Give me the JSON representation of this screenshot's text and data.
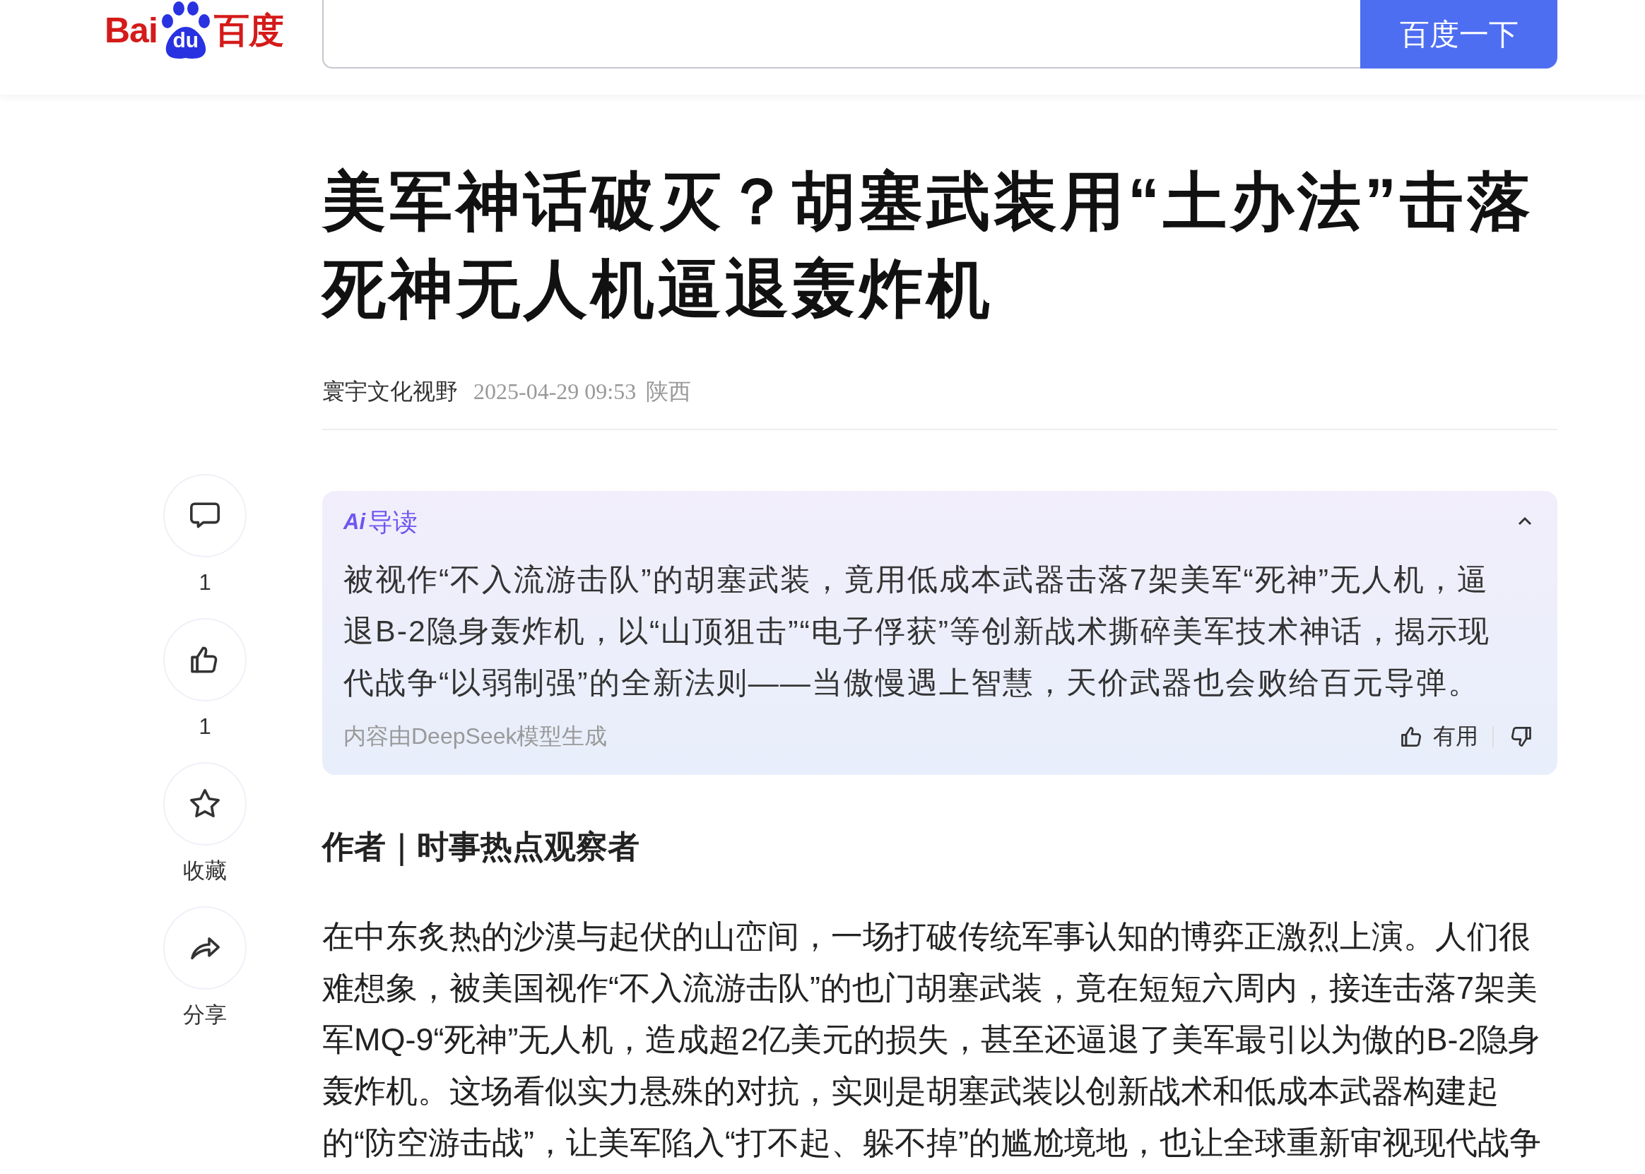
{
  "header": {
    "logo": {
      "text_left": "Bai",
      "paw_text": "du",
      "text_right": "百度"
    },
    "search": {
      "button": "百度一下"
    }
  },
  "article": {
    "title": "美军神话破灭？胡塞武装用“土办法”击落死神无人机逼退轰炸机",
    "source": "寰宇文化视野",
    "time": "2025-04-29 09:53",
    "region": "陕西"
  },
  "actions": [
    {
      "kind": "comment",
      "label": "1"
    },
    {
      "kind": "like",
      "label": "1"
    },
    {
      "kind": "favorite",
      "label": "收藏"
    },
    {
      "kind": "share",
      "label": "分享"
    }
  ],
  "ai_summary": {
    "badge": "Ai",
    "title": "导读",
    "expanded": true,
    "text": "被视作“不入流游击队”的胡塞武装，竟用低成本武器击落7架美军“死神”无人机，逼退B-2隐身轰炸机，以“山顶狙击”“电子俘获”等创新战术撕碎美军技术神话，揭示现代战争“以弱制强”的全新法则——当傲慢遇上智慧，天价武器也会败给百元导弹。",
    "footer": "内容由DeepSeek模型生成",
    "useful": "有用"
  },
  "body": {
    "author_line": "作者｜时事热点观察者",
    "paragraphs": [
      "在中东炙热的沙漠与起伏的山峦间，一场打破传统军事认知的博弈正激烈上演。人们很难想象，被美国视作“不入流游击队”的也门胡塞武装，竟在短短六周内，接连击落7架美军MQ-9“死神”无人机，造成超2亿美元的损失，甚至还逼退了美军最引以为傲的B-2隐身轰炸机。这场看似实力悬殊的对抗，实则是胡塞武装以创新战术和低成本武器构建起的“防空游击战”，让美军陷入“打不起、躲不掉”的尴尬境地，也让全球重新审视现代战争"
    ]
  }
}
